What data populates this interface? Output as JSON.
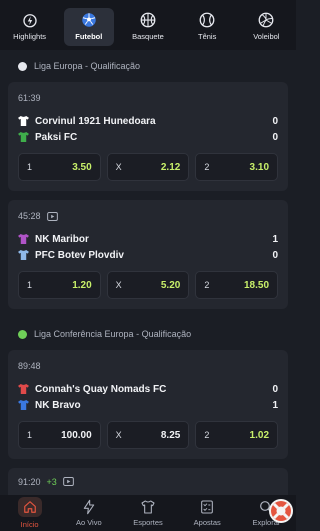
{
  "sports_tabs": [
    {
      "label": "Highlights",
      "icon": "lightning-highlights-icon",
      "active": false
    },
    {
      "label": "Futebol",
      "icon": "soccer-ball-icon",
      "active": true
    },
    {
      "label": "Basquete",
      "icon": "basketball-icon",
      "active": false
    },
    {
      "label": "Tênis",
      "icon": "tennis-ball-icon",
      "active": false
    },
    {
      "label": "Voleibol",
      "icon": "volleyball-icon",
      "active": false
    }
  ],
  "leagues": [
    {
      "name": "Liga Europa - Qualificação",
      "icon_color": "#e6e8ee",
      "matches": [
        {
          "time": "61:39",
          "has_tv": false,
          "home": {
            "name": "Corvinul 1921 Hunedoara",
            "score": "0",
            "shirt_color": "#ffffff"
          },
          "away": {
            "name": "Paksi FC",
            "score": "0",
            "shirt_color": "#3fae4b"
          },
          "odds": [
            {
              "label": "1",
              "value": "3.50"
            },
            {
              "label": "X",
              "value": "2.12"
            },
            {
              "label": "2",
              "value": "3.10"
            }
          ]
        },
        {
          "time": "45:28",
          "has_tv": true,
          "home": {
            "name": "NK Maribor",
            "score": "1",
            "shirt_color": "#b054c8"
          },
          "away": {
            "name": "PFC Botev Plovdiv",
            "score": "0",
            "shirt_color": "#8fb8e8"
          },
          "odds": [
            {
              "label": "1",
              "value": "1.20"
            },
            {
              "label": "X",
              "value": "5.20"
            },
            {
              "label": "2",
              "value": "18.50"
            }
          ]
        }
      ]
    },
    {
      "name": "Liga Conferência Europa - Qualificação",
      "icon_color": "#6fcf58",
      "matches": [
        {
          "time": "89:48",
          "has_tv": false,
          "home": {
            "name": "Connah's Quay Nomads FC",
            "score": "0",
            "shirt_color": "#e04a4a"
          },
          "away": {
            "name": "NK Bravo",
            "score": "1",
            "shirt_color": "#3a78e0"
          },
          "odds": [
            {
              "label": "1",
              "value": "100.00",
              "white": true
            },
            {
              "label": "X",
              "value": "8.25",
              "white": true
            },
            {
              "label": "2",
              "value": "1.02",
              "white": false
            }
          ]
        }
      ]
    }
  ],
  "partial_match": {
    "time": "91:20",
    "extra": "+3",
    "has_tv": true
  },
  "bottom_nav": [
    {
      "label": "Início",
      "icon": "home-icon",
      "active": true
    },
    {
      "label": "Ao Vivo",
      "icon": "lightning-live-icon",
      "active": false
    },
    {
      "label": "Esportes",
      "icon": "jersey-icon",
      "active": false
    },
    {
      "label": "Apostas",
      "icon": "betslip-icon",
      "active": false
    },
    {
      "label": "Explorar",
      "icon": "search-icon",
      "active": false
    }
  ],
  "colors": {
    "accent_odds": "#c8f06a",
    "active_nav": "#e4553f",
    "background": "#1b1e25",
    "card": "#24272f"
  }
}
